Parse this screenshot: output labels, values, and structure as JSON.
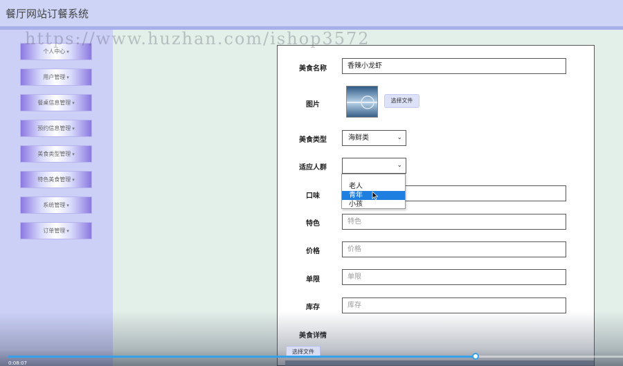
{
  "header": {
    "title": "餐厅网站订餐系统"
  },
  "watermark": "https://www.huzhan.com/ishop3572",
  "sidebar": {
    "items": [
      {
        "label": "个人中心"
      },
      {
        "label": "用户管理"
      },
      {
        "label": "餐桌信息管理"
      },
      {
        "label": "预约信息管理"
      },
      {
        "label": "美食类型管理"
      },
      {
        "label": "特色美食管理"
      },
      {
        "label": "系统管理"
      },
      {
        "label": "订单管理"
      }
    ]
  },
  "form": {
    "name_label": "美食名称",
    "name_value": "香辣小龙虾",
    "image_label": "图片",
    "choose_file": "选择文件",
    "type_label": "美食类型",
    "type_value": "海鲜类",
    "crowd_label": "适应人群",
    "crowd_value": "",
    "crowd_options": [
      "老人",
      "青年",
      "小孩"
    ],
    "crowd_highlighted": "青年",
    "taste_label": "口味",
    "feature_label": "特色",
    "feature_placeholder": "特色",
    "price_label": "价格",
    "price_placeholder": "价格",
    "limit_label": "单限",
    "limit_placeholder": "单限",
    "stock_label": "库存",
    "stock_placeholder": "库存",
    "detail_label": "美食详情",
    "editor_choose_file": "选择文件"
  },
  "player": {
    "time": "0:08:07",
    "progress": 0.76,
    "accent": "#35a1e8"
  }
}
